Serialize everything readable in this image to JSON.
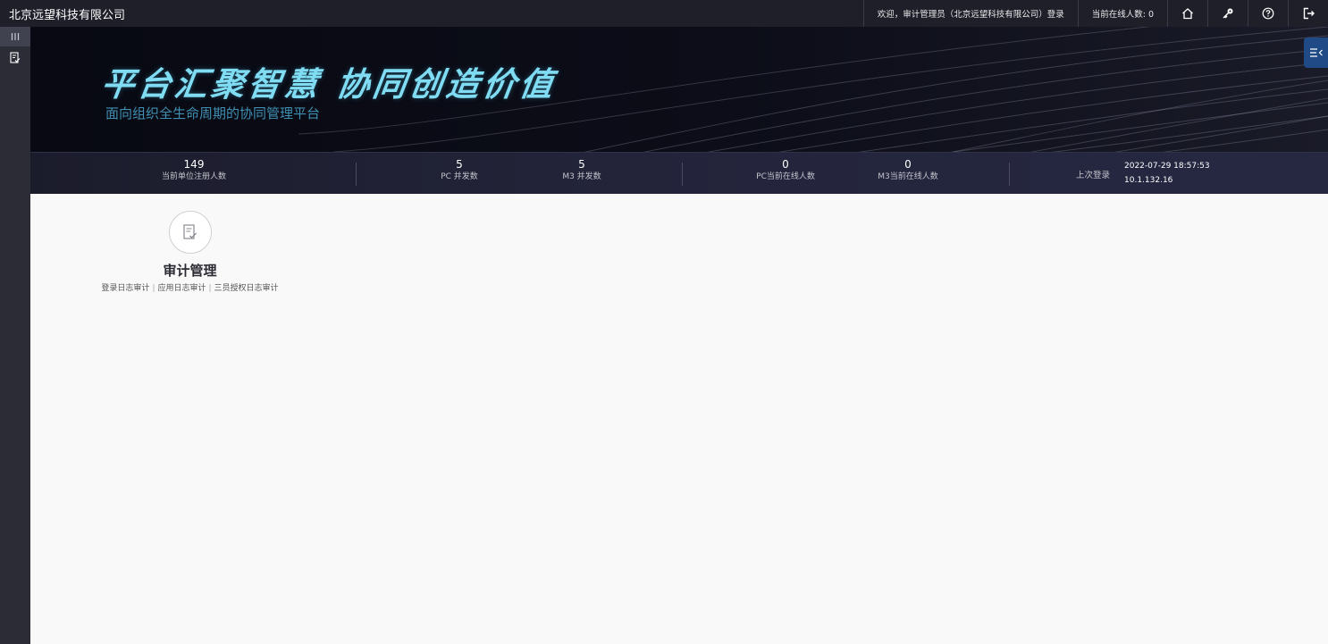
{
  "topbar": {
    "brand": "北京远望科技有限公司",
    "welcome": "欢迎，审计管理员（北京远望科技有限公司）登录",
    "online_users": "当前在线人数: 0",
    "icons": [
      "home-icon",
      "key-icon",
      "help-icon",
      "logout-icon"
    ]
  },
  "sidebar": {
    "toggle_icon": "menu-bars-icon",
    "items": [
      {
        "icon": "audit-doc-icon"
      }
    ]
  },
  "banner": {
    "slogan": "平台汇聚智慧 协同创造价值",
    "subslogan": "面向组织全生命周期的协同管理平台",
    "side_tab_icon": "panel-toggle-icon"
  },
  "stats": {
    "registered": {
      "value": "149",
      "label": "当前单位注册人数"
    },
    "pc_concurrent": {
      "value": "5",
      "label": "PC 并发数"
    },
    "m3_concurrent": {
      "value": "5",
      "label": "M3 并发数"
    },
    "pc_online": {
      "value": "0",
      "label": "PC当前在线人数"
    },
    "m3_online": {
      "value": "0",
      "label": "M3当前在线人数"
    },
    "last_login": {
      "label": "上次登录",
      "time": "2022-07-29 18:57:53",
      "ip": "10.1.132.16"
    }
  },
  "module": {
    "title": "审计管理",
    "links": [
      "登录日志审计",
      "应用日志审计",
      "三员授权日志审计"
    ]
  },
  "colors": {
    "topbar_bg": "#1e1f29",
    "rail_bg": "#2b2c36",
    "banner_bg": "#090a12",
    "slogan": "#7fdcf2",
    "side_tab": "#1f4a86"
  }
}
